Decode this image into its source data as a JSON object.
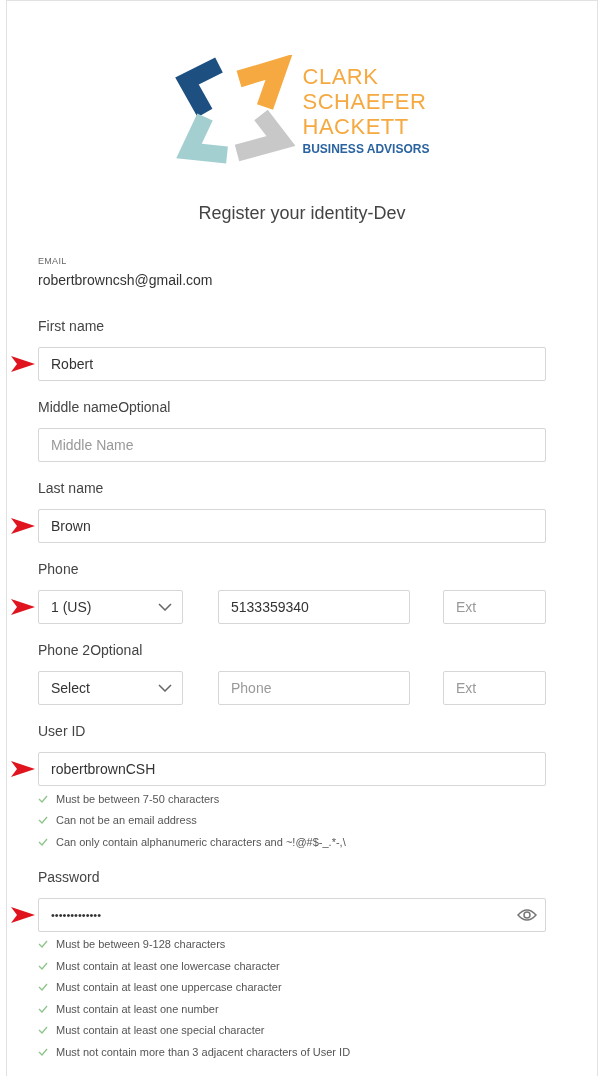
{
  "logo": {
    "lines": [
      "CLARK",
      "SCHAEFER",
      "HACKETT"
    ],
    "tagline": "BUSINESS ADVISORS"
  },
  "title": "Register your identity-Dev",
  "email": {
    "label": "EMAIL",
    "value": "robertbrowncsh@gmail.com"
  },
  "fields": [
    {
      "kind": "text",
      "label": "First name",
      "value": "Robert",
      "marked": true
    },
    {
      "kind": "text",
      "label": "Middle nameOptional",
      "placeholder": "Middle Name",
      "marked": false
    },
    {
      "kind": "text",
      "label": "Last name",
      "value": "Brown",
      "marked": true
    },
    {
      "kind": "phone",
      "label": "Phone",
      "country": "1 (US)",
      "number": {
        "value": "5133359340"
      },
      "ext": {
        "placeholder": "Ext"
      },
      "marked": true
    },
    {
      "kind": "phone",
      "label": "Phone 2Optional",
      "country": "Select",
      "number": {
        "placeholder": "Phone"
      },
      "ext": {
        "placeholder": "Ext"
      },
      "marked": false
    },
    {
      "kind": "text",
      "label": "User ID",
      "value": "robertbrownCSH",
      "marked": true,
      "rules": [
        {
          "text": "Must be between 7-50 characters",
          "met": true
        },
        {
          "text": "Can not be an email address",
          "met": true
        },
        {
          "text": "Can only contain alphanumeric characters and ~!@#$-_.*-,\\",
          "met": true
        }
      ]
    },
    {
      "kind": "password",
      "label": "Password",
      "value": "•••••••••••••",
      "marked": true,
      "rules": [
        {
          "text": "Must be between 9-128 characters",
          "met": true
        },
        {
          "text": "Must contain at least one lowercase character",
          "met": true
        },
        {
          "text": "Must contain at least one uppercase character",
          "met": true
        },
        {
          "text": "Must contain at least one number",
          "met": true
        },
        {
          "text": "Must contain at least one special character",
          "met": true
        },
        {
          "text": "Must not contain more than 3 adjacent characters of User ID",
          "met": true
        }
      ]
    }
  ]
}
